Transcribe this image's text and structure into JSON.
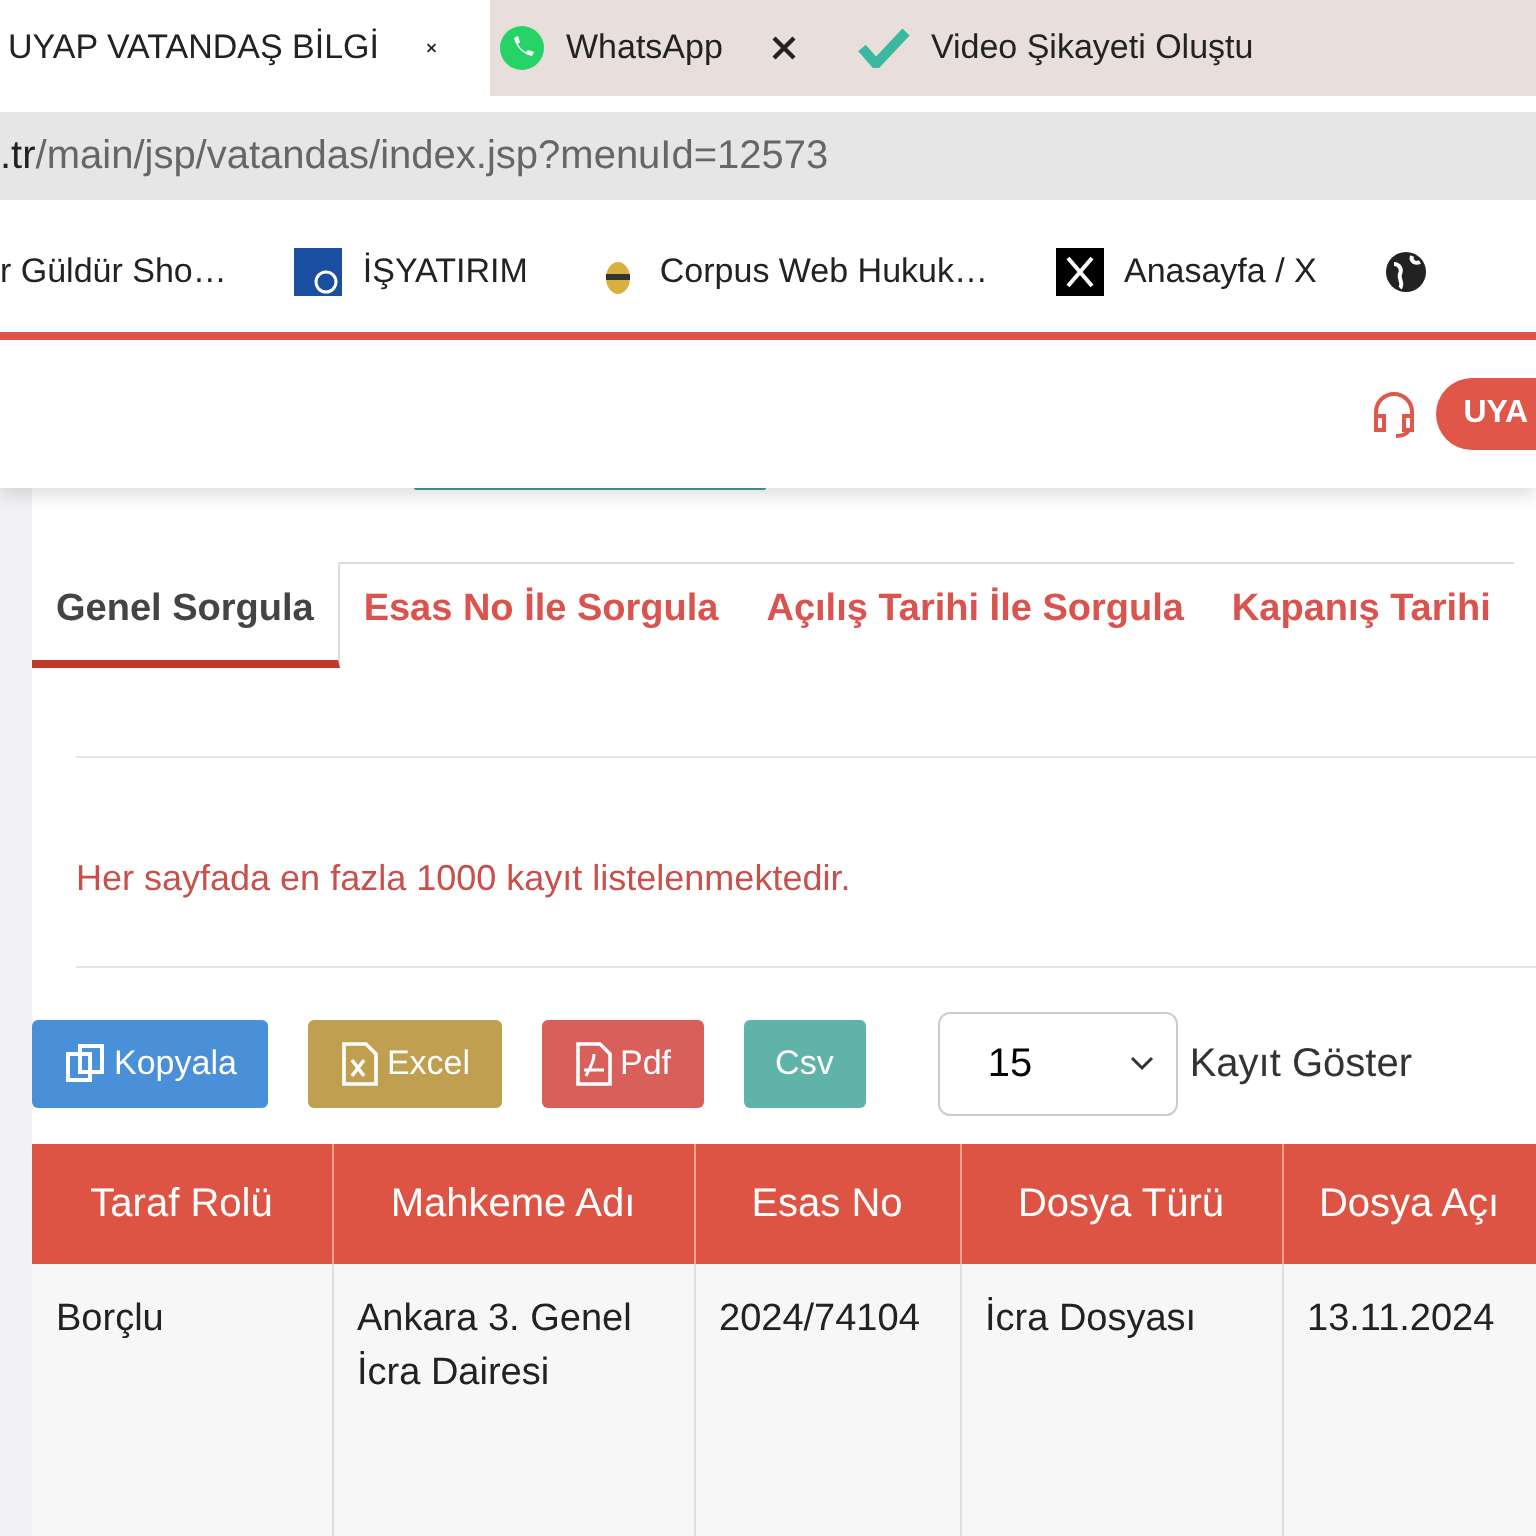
{
  "browser_tabs": [
    {
      "title": "UYAP VATANDAŞ BİLGİ",
      "kind": "page",
      "selected": true
    },
    {
      "title": "WhatsApp",
      "kind": "chat",
      "selected": false
    },
    {
      "title": "Video Şikayeti Oluştu",
      "kind": "video",
      "selected": false
    }
  ],
  "address_bar": {
    "domain": ".tr",
    "path": "/main/jsp/vatandas/index.jsp?menuId=12573"
  },
  "bookmarks": [
    {
      "label": "r Güldür Sho…",
      "kind": "none"
    },
    {
      "label": "İŞYATIRIM",
      "kind": "trade"
    },
    {
      "label": "Corpus Web Hukuk…",
      "kind": "bee"
    },
    {
      "label": "Anasayfa / X",
      "kind": "x"
    },
    {
      "kind": "globe"
    }
  ],
  "header": {
    "button": "UYA"
  },
  "query_tabs": [
    {
      "label": "Genel Sorgula",
      "selected": true
    },
    {
      "label": "Esas No İle Sorgula",
      "selected": false
    },
    {
      "label": "Açılış Tarihi İle Sorgula",
      "selected": false
    },
    {
      "label": "Kapanış Tarihi",
      "selected": false
    }
  ],
  "notice": "Her sayfada en fazla 1000 kayıt listelenmektedir.",
  "export_buttons": [
    {
      "label": "Kopyala",
      "kind": "copy"
    },
    {
      "label": "Excel",
      "kind": "excel"
    },
    {
      "label": "Pdf",
      "kind": "pdf"
    },
    {
      "label": "Csv",
      "kind": "csv"
    }
  ],
  "page_size": {
    "value": "15",
    "label": "Kayıt Göster"
  },
  "table": {
    "columns": [
      "Taraf Rolü",
      "Mahkeme Adı",
      "Esas No",
      "Dosya Türü",
      "Dosya Açı"
    ],
    "rows": [
      [
        "Borçlu",
        "Ankara 3. Genel İcra Dairesi",
        "2024/74104",
        "İcra Dosyası",
        "13.11.2024"
      ]
    ]
  }
}
